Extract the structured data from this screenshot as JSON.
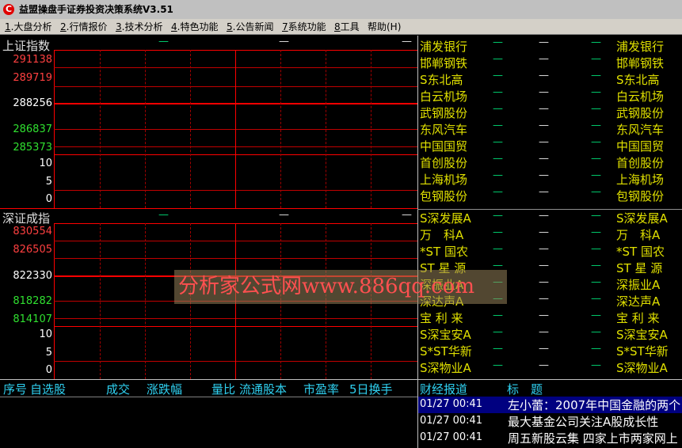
{
  "window": {
    "title": "益盟操盘手证券投资决策系统V3.51",
    "icon_letter": "C"
  },
  "menu": [
    {
      "key": "1",
      "label": ".大盘分析"
    },
    {
      "key": "2",
      "label": ".行情报价"
    },
    {
      "key": "3",
      "label": ".技术分析"
    },
    {
      "key": "4",
      "label": ".特色功能"
    },
    {
      "key": "5",
      "label": ".公告新闻"
    },
    {
      "key": "7",
      "label": "系统功能"
    },
    {
      "key": "8",
      "label": "工具"
    },
    {
      "key": "",
      "label": "帮助(H)"
    }
  ],
  "sh_panel": {
    "title": "上证指数",
    "dashes": [
      "—",
      "—",
      "—"
    ],
    "axis": [
      {
        "v": "291138",
        "c": "red"
      },
      {
        "v": "289719",
        "c": "red"
      },
      {
        "v": "288256",
        "c": "white"
      },
      {
        "v": "286837",
        "c": "green"
      },
      {
        "v": "285373",
        "c": "green"
      },
      {
        "v": "10",
        "c": "white"
      },
      {
        "v": "5",
        "c": "white"
      },
      {
        "v": "0",
        "c": "white"
      }
    ]
  },
  "sz_panel": {
    "title": "深证成指",
    "dashes": [
      "—",
      "—",
      "—"
    ],
    "axis": [
      {
        "v": "830554",
        "c": "red"
      },
      {
        "v": "826505",
        "c": "red"
      },
      {
        "v": "822330",
        "c": "white"
      },
      {
        "v": "818282",
        "c": "green"
      },
      {
        "v": "814107",
        "c": "green"
      },
      {
        "v": "10",
        "c": "white"
      },
      {
        "v": "5",
        "c": "white"
      },
      {
        "v": "0",
        "c": "white"
      }
    ]
  },
  "stocks_top": [
    "浦发银行",
    "邯郸钢铁",
    "S东北高",
    "白云机场",
    "武钢股份",
    "东风汽车",
    "中国国贸",
    "首创股份",
    "上海机场",
    "包钢股份"
  ],
  "stocks_bottom": [
    "S深发展A",
    "万　科A",
    "*ST 国农",
    "ST 星 源",
    "深振业A",
    "深达声A",
    "宝 利 来",
    "S深宝安A",
    "S*ST华新",
    "S深物业A"
  ],
  "stock_dash": "—",
  "watermark": "分析家公式网www.886qq.com",
  "table_header": [
    "序号",
    "自选股",
    "成交",
    "涨跌幅",
    "量比",
    "流通股本",
    "市盈率",
    "5日换手"
  ],
  "news": {
    "header_left": "财经报道",
    "header_right": "标　题",
    "items": [
      {
        "time": "01/27 00:41",
        "title": "左小蕾：2007年中国金融的两个"
      },
      {
        "time": "01/27 00:41",
        "title": "最大基金公司关注A股成长性"
      },
      {
        "time": "01/27 00:41",
        "title": "周五新股云集 四家上市两家网上"
      }
    ]
  },
  "colors": {
    "grid_red": "#ff0000",
    "stock_name": "#e0e000",
    "header_cyan": "#2fd0f0",
    "selected_row": "#000080"
  }
}
